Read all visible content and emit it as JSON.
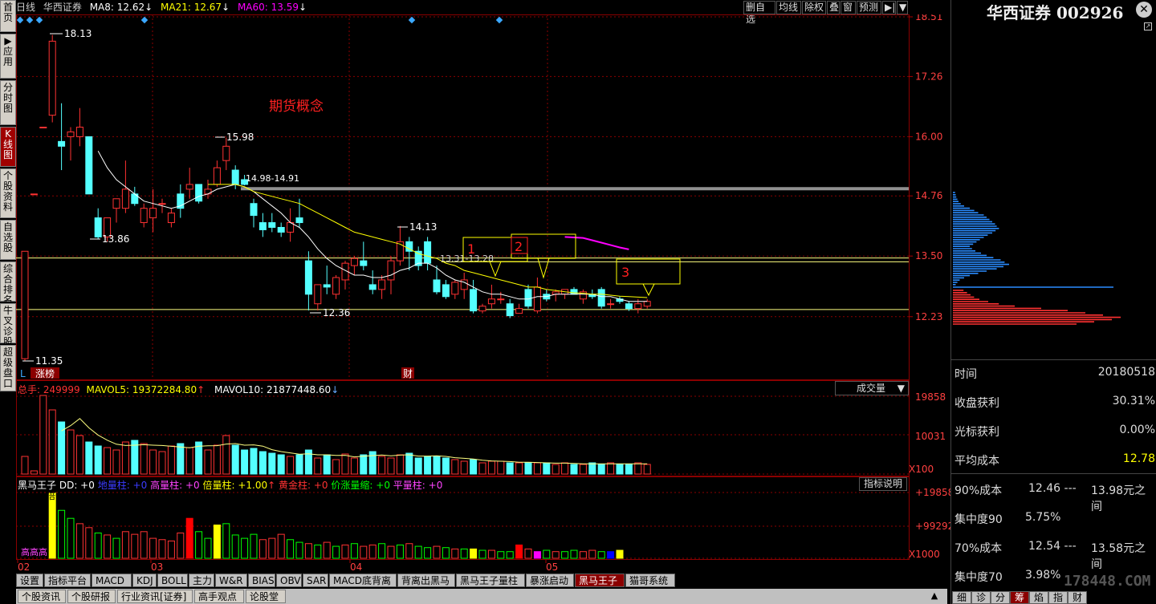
{
  "left_nav": [
    "首页",
    "▶应用",
    "分时图",
    "K线图",
    "个股资料",
    "自选股",
    "综合排名",
    "牛叉诊股",
    "超级盘口"
  ],
  "left_nav_active": 3,
  "header": {
    "period": "日线",
    "stock_name": "华西证券",
    "ma8": "MA8: 12.62",
    "ma21": "MA21: 12.67",
    "ma60": "MA60: 13.59",
    "arrow": "↓"
  },
  "toolbar": [
    "删自选",
    "均线",
    "除权",
    "叠",
    "窗",
    "预测",
    "▶|",
    "▼"
  ],
  "price_axis": [
    "18.51",
    "17.26",
    "16.00",
    "14.76",
    "13.50",
    "12.23"
  ],
  "annotations": {
    "concept": "期货概念",
    "high": "18.13",
    "high2": "15.98",
    "low1": "13.86",
    "range": "14.98-14.91",
    "peak3": "14.13",
    "low2": "12.36",
    "low0": "11.35",
    "mid": "13.31-13.28",
    "box1": "1",
    "box2": "2",
    "box3": "3",
    "zhangbang": "涨榜",
    "cai": "财",
    "L": "L"
  },
  "volume_header": {
    "total": "总手: 249999",
    "mavol5": "MAVOL5: 19372284.80",
    "mavol10": "MAVOL10: 21877448.60",
    "dropdown": "成交量"
  },
  "volume_axis": [
    "19858",
    "10031",
    "X100"
  ],
  "indicator_header": {
    "name": "黑马王子",
    "dd": "DD: +0",
    "diliang": "地量柱: +0",
    "gaoliang": "高量柱: +0",
    "beiliang": "倍量柱: +1.00",
    "huangjin": "黄金柱: +0",
    "jiazhang": "价涨量缩: +0",
    "pingliang": "平量柱: +0",
    "explain_btn": "指标说明"
  },
  "indicator_axis": [
    "+198584",
    "+99292",
    "X1000"
  ],
  "indicator_labels": {
    "gaogao": "高高高",
    "bei": "倍"
  },
  "x_axis": [
    "02",
    "03",
    "04",
    "05"
  ],
  "right_panel": {
    "title": "华西证券 002926",
    "rows": [
      {
        "k": "时间",
        "v": "20180518"
      },
      {
        "k": "收盘获利",
        "v": "30.31%"
      },
      {
        "k": "光标获利",
        "v": "0.00%"
      },
      {
        "k": "平均成本",
        "v": "12.78"
      }
    ],
    "cost90": {
      "k": "90%成本",
      "a": "12.46 ---",
      "b": "13.98元之间"
    },
    "conc90": {
      "k": "集中度90",
      "v": "5.75%"
    },
    "cost70": {
      "k": "70%成本",
      "a": "12.54 ---",
      "b": "13.58元之间"
    },
    "conc70": {
      "k": "集中度70",
      "v": "3.98%"
    },
    "watermark": "178448.COM"
  },
  "tabs_row1": [
    "设置",
    "指标平台",
    "MACD",
    "KDJ",
    "BOLL",
    "主力",
    "W&R",
    "BIAS",
    "OBV",
    "SAR",
    "MACD底背离",
    "背离出黑马",
    "黑马王子量柱",
    "暴涨启动",
    "黑马王子",
    "猫哥系统"
  ],
  "tabs_row1_active": 14,
  "tabs_row2": [
    "个股资讯",
    "个股研报",
    "行业资讯[证券]",
    "高手观点",
    "论股堂"
  ],
  "right_tabs": [
    "细",
    "诊",
    "分",
    "筹",
    "焰",
    "指",
    "财"
  ],
  "right_tabs_active": 3,
  "colors": {
    "up": "#ff3232",
    "down": "#54ffff",
    "ma_white": "#ffffff",
    "ma_yellow": "#ffff00",
    "ma_magenta": "#ff00ff",
    "grid": "#8b0000"
  },
  "candles": [
    {
      "o": 11.35,
      "h": 13.6,
      "l": 11.3,
      "c": 13.6
    },
    {
      "o": 14.8,
      "h": 14.8,
      "l": 14.8,
      "c": 14.8
    },
    {
      "o": 16.2,
      "h": 16.2,
      "l": 16.2,
      "c": 16.2
    },
    {
      "o": 16.45,
      "h": 18.13,
      "l": 16.3,
      "c": 18.0
    },
    {
      "o": 15.9,
      "h": 16.7,
      "l": 15.3,
      "c": 15.8
    },
    {
      "o": 16.0,
      "h": 16.2,
      "l": 15.5,
      "c": 16.1
    },
    {
      "o": 16.0,
      "h": 16.6,
      "l": 15.8,
      "c": 16.2
    },
    {
      "o": 16.0,
      "h": 16.0,
      "l": 14.8,
      "c": 14.8
    },
    {
      "o": 14.3,
      "h": 14.5,
      "l": 13.86,
      "c": 13.9
    },
    {
      "o": 13.9,
      "h": 14.3,
      "l": 13.8,
      "c": 14.3
    },
    {
      "o": 14.5,
      "h": 14.7,
      "l": 14.2,
      "c": 14.7
    },
    {
      "o": 14.5,
      "h": 15.5,
      "l": 14.4,
      "c": 14.9
    },
    {
      "o": 14.8,
      "h": 14.95,
      "l": 14.55,
      "c": 14.6
    },
    {
      "o": 14.2,
      "h": 14.6,
      "l": 14.1,
      "c": 14.5
    },
    {
      "o": 14.3,
      "h": 14.9,
      "l": 14.0,
      "c": 14.5
    },
    {
      "o": 14.6,
      "h": 14.7,
      "l": 14.4,
      "c": 14.6
    },
    {
      "o": 14.2,
      "h": 14.5,
      "l": 14.1,
      "c": 14.4
    },
    {
      "o": 14.8,
      "h": 15.0,
      "l": 14.3,
      "c": 14.5
    },
    {
      "o": 14.9,
      "h": 15.35,
      "l": 14.7,
      "c": 15.0
    },
    {
      "o": 15.0,
      "h": 15.0,
      "l": 14.6,
      "c": 14.65
    },
    {
      "o": 14.8,
      "h": 15.1,
      "l": 14.7,
      "c": 14.9
    },
    {
      "o": 15.0,
      "h": 15.5,
      "l": 14.95,
      "c": 15.35
    },
    {
      "o": 15.5,
      "h": 15.98,
      "l": 15.3,
      "c": 15.8
    },
    {
      "o": 15.3,
      "h": 15.4,
      "l": 14.9,
      "c": 15.0
    },
    {
      "o": 15.1,
      "h": 15.2,
      "l": 14.98,
      "c": 15.0
    },
    {
      "o": 14.6,
      "h": 14.7,
      "l": 14.1,
      "c": 14.35
    },
    {
      "o": 14.2,
      "h": 14.4,
      "l": 13.9,
      "c": 14.05
    },
    {
      "o": 14.2,
      "h": 14.4,
      "l": 14.0,
      "c": 14.1
    },
    {
      "o": 14.1,
      "h": 14.2,
      "l": 13.9,
      "c": 14.0
    },
    {
      "o": 14.0,
      "h": 14.5,
      "l": 13.8,
      "c": 14.2
    },
    {
      "o": 14.3,
      "h": 14.7,
      "l": 14.1,
      "c": 14.2
    },
    {
      "o": 13.4,
      "h": 13.6,
      "l": 12.36,
      "c": 12.7
    },
    {
      "o": 12.5,
      "h": 12.9,
      "l": 12.36,
      "c": 12.9
    },
    {
      "o": 12.9,
      "h": 13.3,
      "l": 12.7,
      "c": 12.85
    },
    {
      "o": 12.7,
      "h": 13.1,
      "l": 12.6,
      "c": 13.05
    },
    {
      "o": 13.0,
      "h": 13.4,
      "l": 12.8,
      "c": 13.35
    },
    {
      "o": 13.3,
      "h": 13.5,
      "l": 13.1,
      "c": 13.45
    },
    {
      "o": 13.4,
      "h": 13.8,
      "l": 13.2,
      "c": 13.3
    },
    {
      "o": 12.9,
      "h": 13.2,
      "l": 12.7,
      "c": 12.8
    },
    {
      "o": 12.8,
      "h": 13.1,
      "l": 12.6,
      "c": 13.0
    },
    {
      "o": 13.0,
      "h": 13.5,
      "l": 12.7,
      "c": 13.4
    },
    {
      "o": 13.4,
      "h": 14.13,
      "l": 13.3,
      "c": 13.8
    },
    {
      "o": 13.8,
      "h": 13.9,
      "l": 13.2,
      "c": 13.6
    },
    {
      "o": 13.6,
      "h": 13.7,
      "l": 13.2,
      "c": 13.3
    },
    {
      "o": 13.8,
      "h": 13.9,
      "l": 13.2,
      "c": 13.35
    },
    {
      "o": 13.0,
      "h": 13.3,
      "l": 12.7,
      "c": 12.75
    },
    {
      "o": 12.9,
      "h": 13.0,
      "l": 12.6,
      "c": 12.65
    },
    {
      "o": 12.7,
      "h": 13.0,
      "l": 12.6,
      "c": 12.95
    },
    {
      "o": 12.8,
      "h": 13.15,
      "l": 12.6,
      "c": 13.0
    },
    {
      "o": 12.8,
      "h": 13.0,
      "l": 12.3,
      "c": 12.35
    },
    {
      "o": 12.35,
      "h": 12.5,
      "l": 12.3,
      "c": 12.45
    },
    {
      "o": 12.5,
      "h": 12.9,
      "l": 12.4,
      "c": 12.6
    },
    {
      "o": 12.6,
      "h": 12.75,
      "l": 12.5,
      "c": 12.6
    },
    {
      "o": 12.5,
      "h": 12.6,
      "l": 12.2,
      "c": 12.25
    },
    {
      "o": 12.3,
      "h": 12.5,
      "l": 12.3,
      "c": 12.4
    },
    {
      "o": 12.8,
      "h": 12.9,
      "l": 12.4,
      "c": 12.45
    },
    {
      "o": 12.35,
      "h": 13.05,
      "l": 12.3,
      "c": 12.85
    },
    {
      "o": 12.7,
      "h": 12.8,
      "l": 12.55,
      "c": 12.6
    },
    {
      "o": 12.7,
      "h": 12.8,
      "l": 12.55,
      "c": 12.75
    },
    {
      "o": 12.7,
      "h": 12.8,
      "l": 12.6,
      "c": 12.8
    },
    {
      "o": 12.8,
      "h": 12.85,
      "l": 12.7,
      "c": 12.7
    },
    {
      "o": 12.6,
      "h": 12.8,
      "l": 12.5,
      "c": 12.75
    },
    {
      "o": 12.7,
      "h": 12.8,
      "l": 12.6,
      "c": 12.65
    },
    {
      "o": 12.8,
      "h": 12.85,
      "l": 12.4,
      "c": 12.45
    },
    {
      "o": 12.5,
      "h": 12.6,
      "l": 12.4,
      "c": 12.5
    },
    {
      "o": 12.6,
      "h": 12.65,
      "l": 12.5,
      "c": 12.55
    },
    {
      "o": 12.5,
      "h": 12.55,
      "l": 12.35,
      "c": 12.4
    },
    {
      "o": 12.4,
      "h": 12.6,
      "l": 12.3,
      "c": 12.5
    },
    {
      "o": 12.45,
      "h": 12.6,
      "l": 12.4,
      "c": 12.55
    }
  ],
  "ma_white": [
    null,
    null,
    null,
    null,
    null,
    null,
    null,
    null,
    15.7,
    15.35,
    15.1,
    14.95,
    14.8,
    14.65,
    14.6,
    14.55,
    14.5,
    14.55,
    14.65,
    14.75,
    14.8,
    14.9,
    14.95,
    15.0,
    14.95,
    14.85,
    14.7,
    14.55,
    14.4,
    14.2,
    14.1,
    13.9,
    13.65,
    13.45,
    13.3,
    13.2,
    13.1,
    13.1,
    13.05,
    13.05,
    13.1,
    13.2,
    13.25,
    13.35,
    13.35,
    13.25,
    13.1,
    13.0,
    12.95,
    12.85,
    12.75,
    12.7,
    12.7,
    12.65,
    12.6,
    12.6,
    12.65,
    12.65,
    12.7,
    12.7,
    12.7,
    12.7,
    12.7,
    12.65,
    12.65,
    12.6,
    12.55,
    12.55,
    12.55
  ],
  "ma_yellow": [
    null,
    null,
    null,
    null,
    null,
    null,
    null,
    null,
    null,
    null,
    null,
    null,
    null,
    null,
    null,
    null,
    null,
    null,
    null,
    null,
    15.0,
    15.0,
    15.0,
    15.0,
    14.95,
    14.85,
    14.8,
    14.75,
    14.7,
    14.65,
    14.6,
    14.5,
    14.4,
    14.3,
    14.2,
    14.1,
    14.0,
    13.95,
    13.9,
    13.85,
    13.8,
    13.75,
    13.65,
    13.55,
    13.5,
    13.45,
    13.35,
    13.3,
    13.2,
    13.15,
    13.1,
    13.05,
    13.0,
    12.95,
    12.9,
    12.85,
    12.85,
    12.8,
    12.78,
    12.75,
    12.73,
    12.72,
    12.7,
    12.7,
    12.68,
    12.66,
    12.65,
    12.64,
    12.63
  ],
  "ma_magenta": [
    {
      "i": 59,
      "v": 13.9
    },
    {
      "i": 61,
      "v": 13.88
    },
    {
      "i": 63,
      "v": 13.78
    },
    {
      "i": 65,
      "v": 13.68
    },
    {
      "i": 66,
      "v": 13.64
    }
  ],
  "volumes": [
    22,
    4,
    98,
    80,
    65,
    55,
    48,
    40,
    35,
    33,
    30,
    40,
    42,
    38,
    30,
    28,
    35,
    38,
    33,
    40,
    30,
    36,
    48,
    36,
    30,
    32,
    28,
    26,
    24,
    22,
    24,
    30,
    20,
    24,
    18,
    25,
    20,
    24,
    28,
    22,
    20,
    24,
    26,
    20,
    22,
    22,
    20,
    18,
    16,
    18,
    14,
    16,
    16,
    14,
    14,
    14,
    14,
    14,
    12,
    14,
    12,
    12,
    14,
    12,
    14,
    12,
    12,
    14,
    12
  ],
  "ind_bars": [
    {
      "i": 3,
      "v": 98,
      "c": "#ffff00"
    },
    {
      "i": 4,
      "v": 72,
      "c": "#00ff00"
    },
    {
      "i": 5,
      "v": 60,
      "c": "#00ff00"
    },
    {
      "i": 6,
      "v": 52,
      "c": "#ff3232"
    },
    {
      "i": 7,
      "v": 46,
      "c": "#ff3232"
    },
    {
      "i": 8,
      "v": 38,
      "c": "#00ff00"
    },
    {
      "i": 9,
      "v": 35,
      "c": "#ff3232"
    },
    {
      "i": 10,
      "v": 30,
      "c": "#00ff00"
    },
    {
      "i": 11,
      "v": 40,
      "c": "#ff3232"
    },
    {
      "i": 12,
      "v": 36,
      "c": "#ff3232"
    },
    {
      "i": 13,
      "v": 40,
      "c": "#ff3232"
    },
    {
      "i": 14,
      "v": 30,
      "c": "#ff3232"
    },
    {
      "i": 15,
      "v": 28,
      "c": "#ff3232"
    },
    {
      "i": 16,
      "v": 26,
      "c": "#ff3232"
    },
    {
      "i": 17,
      "v": 38,
      "c": "#ff3232"
    },
    {
      "i": 18,
      "v": 60,
      "c": "#ff0000"
    },
    {
      "i": 19,
      "v": 40,
      "c": "#00ff00"
    },
    {
      "i": 20,
      "v": 30,
      "c": "#00ff00"
    },
    {
      "i": 21,
      "v": 50,
      "c": "#ffff00"
    },
    {
      "i": 22,
      "v": 52,
      "c": "#00ff00"
    },
    {
      "i": 23,
      "v": 35,
      "c": "#00ff00"
    },
    {
      "i": 24,
      "v": 30,
      "c": "#00ff00"
    },
    {
      "i": 25,
      "v": 36,
      "c": "#00ff00"
    },
    {
      "i": 26,
      "v": 28,
      "c": "#ff3232"
    },
    {
      "i": 27,
      "v": 30,
      "c": "#ff3232"
    },
    {
      "i": 28,
      "v": 36,
      "c": "#ff3232"
    },
    {
      "i": 29,
      "v": 28,
      "c": "#00ff00"
    },
    {
      "i": 30,
      "v": 24,
      "c": "#00ff00"
    },
    {
      "i": 31,
      "v": 22,
      "c": "#ff3232"
    },
    {
      "i": 32,
      "v": 20,
      "c": "#00ff00"
    },
    {
      "i": 33,
      "v": 24,
      "c": "#ff3232"
    },
    {
      "i": 34,
      "v": 18,
      "c": "#00ff00"
    },
    {
      "i": 35,
      "v": 20,
      "c": "#ff3232"
    },
    {
      "i": 36,
      "v": 22,
      "c": "#00ff00"
    },
    {
      "i": 37,
      "v": 18,
      "c": "#ff3232"
    },
    {
      "i": 38,
      "v": 20,
      "c": "#ff3232"
    },
    {
      "i": 39,
      "v": 22,
      "c": "#00ff00"
    },
    {
      "i": 40,
      "v": 18,
      "c": "#ff3232"
    },
    {
      "i": 41,
      "v": 20,
      "c": "#00ff00"
    },
    {
      "i": 42,
      "v": 22,
      "c": "#ff3232"
    },
    {
      "i": 43,
      "v": 18,
      "c": "#00ff00"
    },
    {
      "i": 44,
      "v": 16,
      "c": "#00ff00"
    },
    {
      "i": 45,
      "v": 18,
      "c": "#ff3232"
    },
    {
      "i": 46,
      "v": 16,
      "c": "#00ff00"
    },
    {
      "i": 47,
      "v": 14,
      "c": "#ff3232"
    },
    {
      "i": 48,
      "v": 14,
      "c": "#00ff00"
    },
    {
      "i": 49,
      "v": 14,
      "c": "#ffff00"
    },
    {
      "i": 50,
      "v": 12,
      "c": "#00ff00"
    },
    {
      "i": 51,
      "v": 12,
      "c": "#ff3232"
    },
    {
      "i": 52,
      "v": 10,
      "c": "#00ff00"
    },
    {
      "i": 53,
      "v": 10,
      "c": "#00ff00"
    },
    {
      "i": 54,
      "v": 20,
      "c": "#ff0000"
    },
    {
      "i": 55,
      "v": 14,
      "c": "#ff3232"
    },
    {
      "i": 56,
      "v": 10,
      "c": "#ff00ff"
    },
    {
      "i": 57,
      "v": 12,
      "c": "#00ff00"
    },
    {
      "i": 58,
      "v": 10,
      "c": "#ff3232"
    },
    {
      "i": 59,
      "v": 10,
      "c": "#00ff00"
    },
    {
      "i": 60,
      "v": 12,
      "c": "#00ff00"
    },
    {
      "i": 61,
      "v": 10,
      "c": "#ff3232"
    },
    {
      "i": 62,
      "v": 12,
      "c": "#ff3232"
    },
    {
      "i": 63,
      "v": 10,
      "c": "#00ff00"
    },
    {
      "i": 64,
      "v": 10,
      "c": "#0000ff"
    },
    {
      "i": 65,
      "v": 12,
      "c": "#ffff00"
    }
  ],
  "chip_up": [
    0.06,
    0.08,
    0.1,
    0.12,
    0.15,
    0.2,
    0.26,
    0.35,
    0.5,
    0.65,
    0.75,
    0.85,
    0.95,
    0.9,
    0.8,
    0.7
  ],
  "chip_down": [
    0.04,
    0.05,
    0.06,
    0.08,
    0.1,
    0.14,
    0.2,
    0.3,
    0.38,
    0.45,
    0.55,
    0.6,
    0.65,
    0.7,
    0.75,
    0.78,
    0.82,
    0.76,
    0.7,
    0.62,
    0.55,
    0.48,
    0.42,
    0.36,
    0.3,
    0.34,
    0.4,
    0.5,
    0.6,
    0.72,
    0.85,
    0.92,
    1.0,
    0.9,
    0.78,
    0.6,
    0.45,
    0.3,
    0.2,
    0.12,
    0.08,
    0.05
  ]
}
